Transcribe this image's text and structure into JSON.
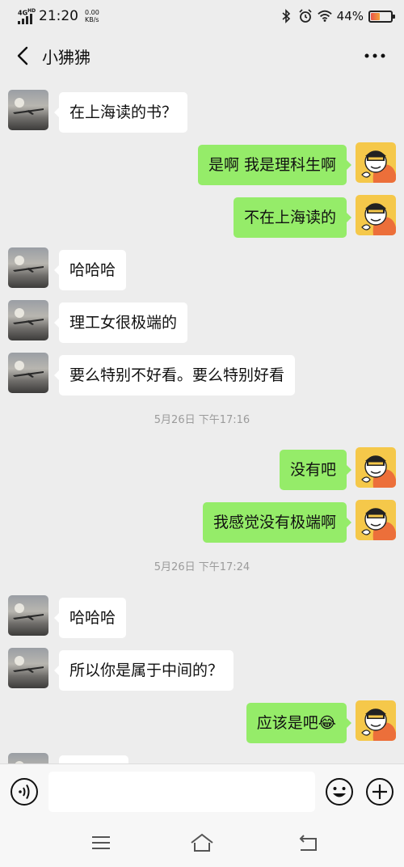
{
  "status_bar": {
    "network": "4G",
    "network_badge": "HD",
    "time": "21:20",
    "speed_value": "0.00",
    "speed_unit": "KB/s",
    "battery_percent": "44%",
    "battery_level": 0.44,
    "icons": [
      "signal-icon",
      "bluetooth-icon",
      "alarm-icon",
      "wifi-icon",
      "battery-icon"
    ]
  },
  "header": {
    "title": "小狒狒",
    "back_icon": "chevron-left-icon",
    "more_icon": "more-icon"
  },
  "messages": [
    {
      "side": "left",
      "text": "在上海读的书？"
    },
    {
      "side": "right",
      "text": "是啊  我是理科生啊"
    },
    {
      "side": "right",
      "text": "不在上海读的"
    },
    {
      "side": "left",
      "text": "哈哈哈"
    },
    {
      "side": "left",
      "text": "理工女很极端的"
    },
    {
      "side": "left",
      "text": "要么特别不好看。要么特别好看"
    },
    {
      "timestamp": "5月26日 下午17:16"
    },
    {
      "side": "right",
      "text": "没有吧"
    },
    {
      "side": "right",
      "text": "我感觉没有极端啊"
    },
    {
      "timestamp": "5月26日 下午17:24"
    },
    {
      "side": "left",
      "text": "哈哈哈"
    },
    {
      "side": "left",
      "text": "所以你是属于中间的？"
    },
    {
      "side": "right",
      "text": "应该是吧😂"
    },
    {
      "side": "left",
      "text": ""
    }
  ],
  "input_bar": {
    "value": "",
    "voice_icon": "voice-icon",
    "emoji_icon": "emoji-icon",
    "plus_icon": "plus-icon"
  },
  "system_nav": {
    "icons": [
      "menu-icon",
      "home-icon",
      "back-icon"
    ]
  },
  "colors": {
    "background": "#ededed",
    "my_bubble": "#95ec69",
    "their_bubble": "#ffffff"
  }
}
